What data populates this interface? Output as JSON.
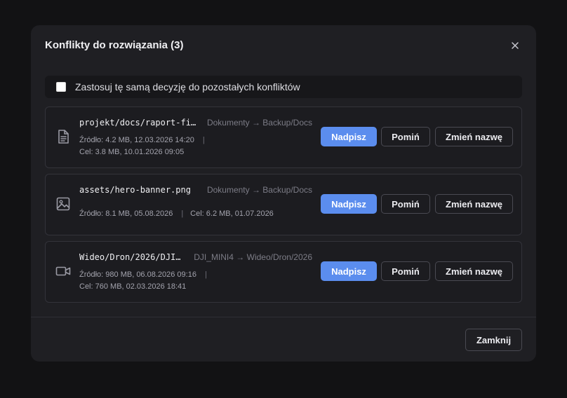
{
  "dialog": {
    "title": "Konflikty do rozwiązania (3)",
    "close_icon": "close-icon",
    "apply_all": {
      "label": "Zastosuj tę samą decyzję do pozostałych konfliktów",
      "checked": false
    },
    "conflicts": [
      {
        "icon": "document-icon",
        "path": "projekt/docs/raport-fi…",
        "route": "Dokumenty → Backup/Docs",
        "source": "Źródło: 4.2 MB, 12.03.2026 14:20",
        "sep": "|",
        "target": "Cel: 3.8 MB, 10.01.2026 09:05",
        "overwrite": "Nadpisz",
        "skip": "Pomiń",
        "rename": "Zmień nazwę"
      },
      {
        "icon": "image-icon",
        "path": "assets/hero-banner.png",
        "route": "Dokumenty → Backup/Docs",
        "source": "Źródło: 8.1 MB, 05.08.2026",
        "sep": "|",
        "target": "Cel: 6.2 MB, 01.07.2026",
        "overwrite": "Nadpisz",
        "skip": "Pomiń",
        "rename": "Zmień nazwę"
      },
      {
        "icon": "video-icon",
        "path": "Wideo/Dron/2026/DJI…",
        "route": "DJI_MINI4 → Wideo/Dron/2026",
        "source": "Źródło: 980 MB, 06.08.2026 09:16",
        "sep": "|",
        "target": "Cel: 760 MB, 02.03.2026 18:41",
        "overwrite": "Nadpisz",
        "skip": "Pomiń",
        "rename": "Zmień nazwę"
      }
    ],
    "footer": {
      "close_label": "Zamknij"
    }
  },
  "colors": {
    "background": "#121214",
    "dialog": "#1f1f23",
    "accent": "#5b8dee"
  }
}
